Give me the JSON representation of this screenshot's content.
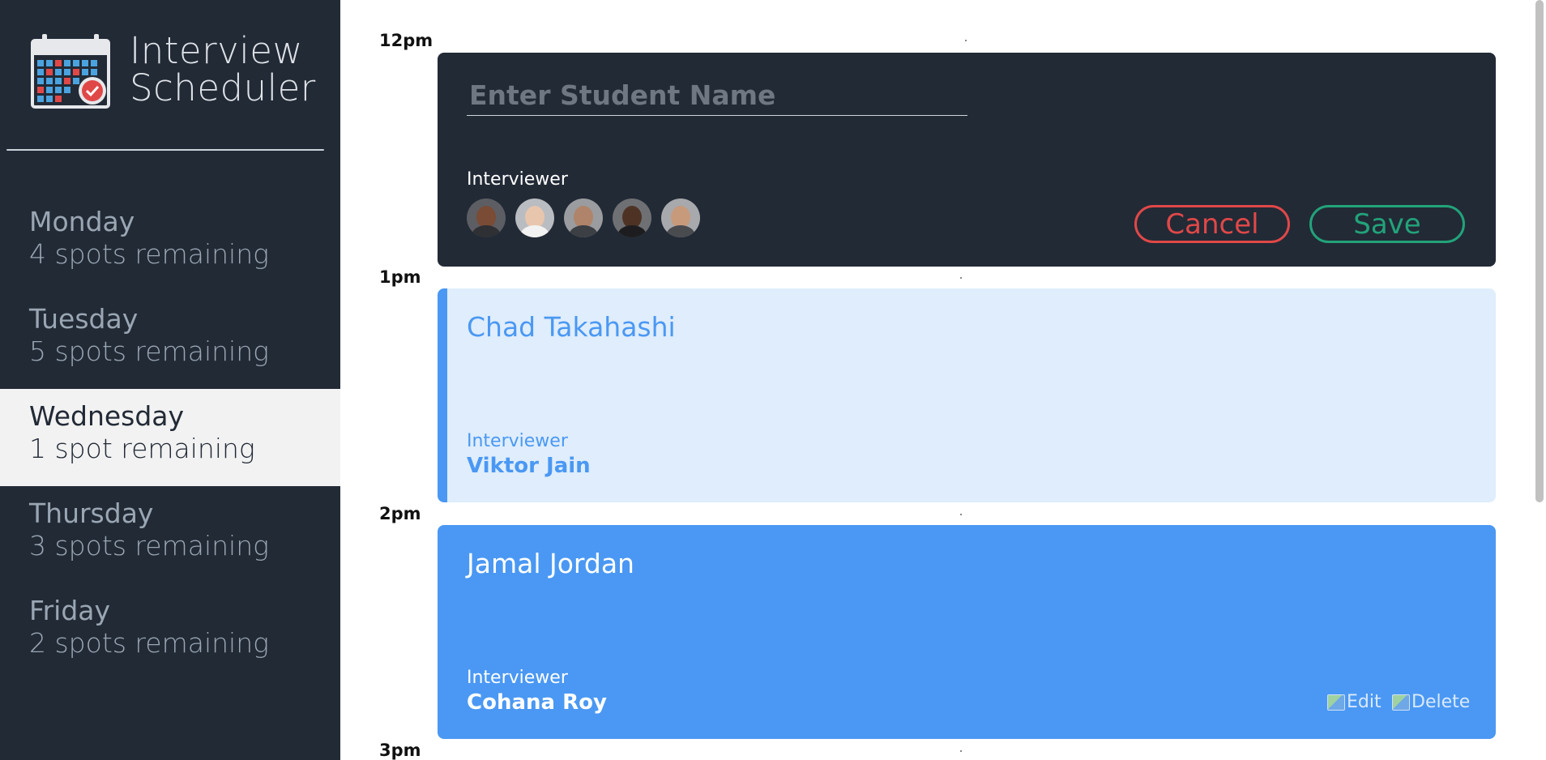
{
  "brand": {
    "line1": "Interview",
    "line2": "Scheduler"
  },
  "days": [
    {
      "name": "Monday",
      "spots": "4 spots remaining"
    },
    {
      "name": "Tuesday",
      "spots": "5 spots remaining"
    },
    {
      "name": "Wednesday",
      "spots": "1 spot remaining"
    },
    {
      "name": "Thursday",
      "spots": "3 spots remaining"
    },
    {
      "name": "Friday",
      "spots": "2 spots remaining"
    }
  ],
  "selected_day": "Wednesday",
  "times": [
    "12pm",
    "1pm",
    "2pm",
    "3pm"
  ],
  "form": {
    "student_placeholder": "Enter Student Name",
    "student_value": "",
    "interviewer_label": "Interviewer",
    "cancel_label": "Cancel",
    "save_label": "Save"
  },
  "appointments": [
    {
      "student": "Chad Takahashi",
      "interviewer_label": "Interviewer",
      "interviewer": "Viktor Jain"
    },
    {
      "student": "Jamal Jordan",
      "interviewer_label": "Interviewer",
      "interviewer": "Cohana Roy",
      "edit_label": "Edit",
      "delete_label": "Delete"
    }
  ],
  "colors": {
    "sidebar": "#222a36",
    "accent_blue": "#4a98f3",
    "light_blue": "#dfedfc",
    "danger": "#e04848",
    "success": "#22a37a"
  }
}
